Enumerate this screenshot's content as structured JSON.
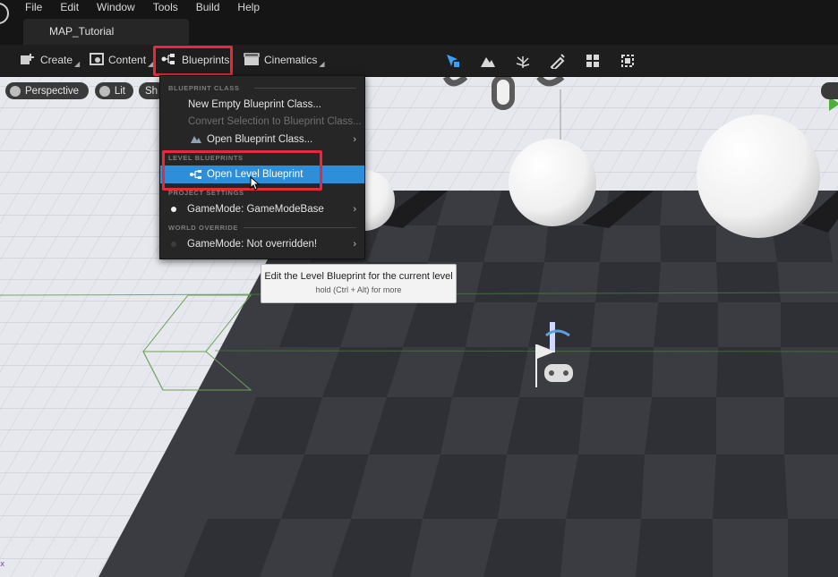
{
  "menubar": {
    "items": [
      "File",
      "Edit",
      "Window",
      "Tools",
      "Build",
      "Help"
    ],
    "document_tab": "MAP_Tutorial"
  },
  "toolbar": {
    "create_label": "Create",
    "content_label": "Content",
    "blueprints_label": "Blueprints",
    "cinematics_label": "Cinematics",
    "mode_icons": [
      "select-mode-icon",
      "landscape-mode-icon",
      "foliage-mode-icon",
      "mesh-paint-mode-icon",
      "fracture-mode-icon",
      "brush-edit-mode-icon"
    ]
  },
  "viewport": {
    "perspective_label": "Perspective",
    "lit_label": "Lit",
    "show_label": "Sh"
  },
  "blueprints_menu": {
    "section_blueprint_class": "BLUEPRINT CLASS",
    "new_empty": "New Empty Blueprint Class...",
    "convert_selection": "Convert Selection to Blueprint Class...",
    "open_class": "Open Blueprint Class...",
    "section_level_blueprints": "LEVEL BLUEPRINTS",
    "open_level_blueprint": "Open Level Blueprint",
    "section_project_settings": "PROJECT SETTINGS",
    "gamemode_base": "GameMode: GameModeBase",
    "section_world_override": "WORLD OVERRIDE",
    "gamemode_override": "GameMode: Not overridden!"
  },
  "tooltip": {
    "title": "Edit the Level Blueprint for the current level",
    "hint": "hold (Ctrl + Alt) for more"
  },
  "colors": {
    "highlight_red": "#e8293a",
    "selection_blue": "#2e8fd8",
    "play_green": "#4caf3a"
  }
}
